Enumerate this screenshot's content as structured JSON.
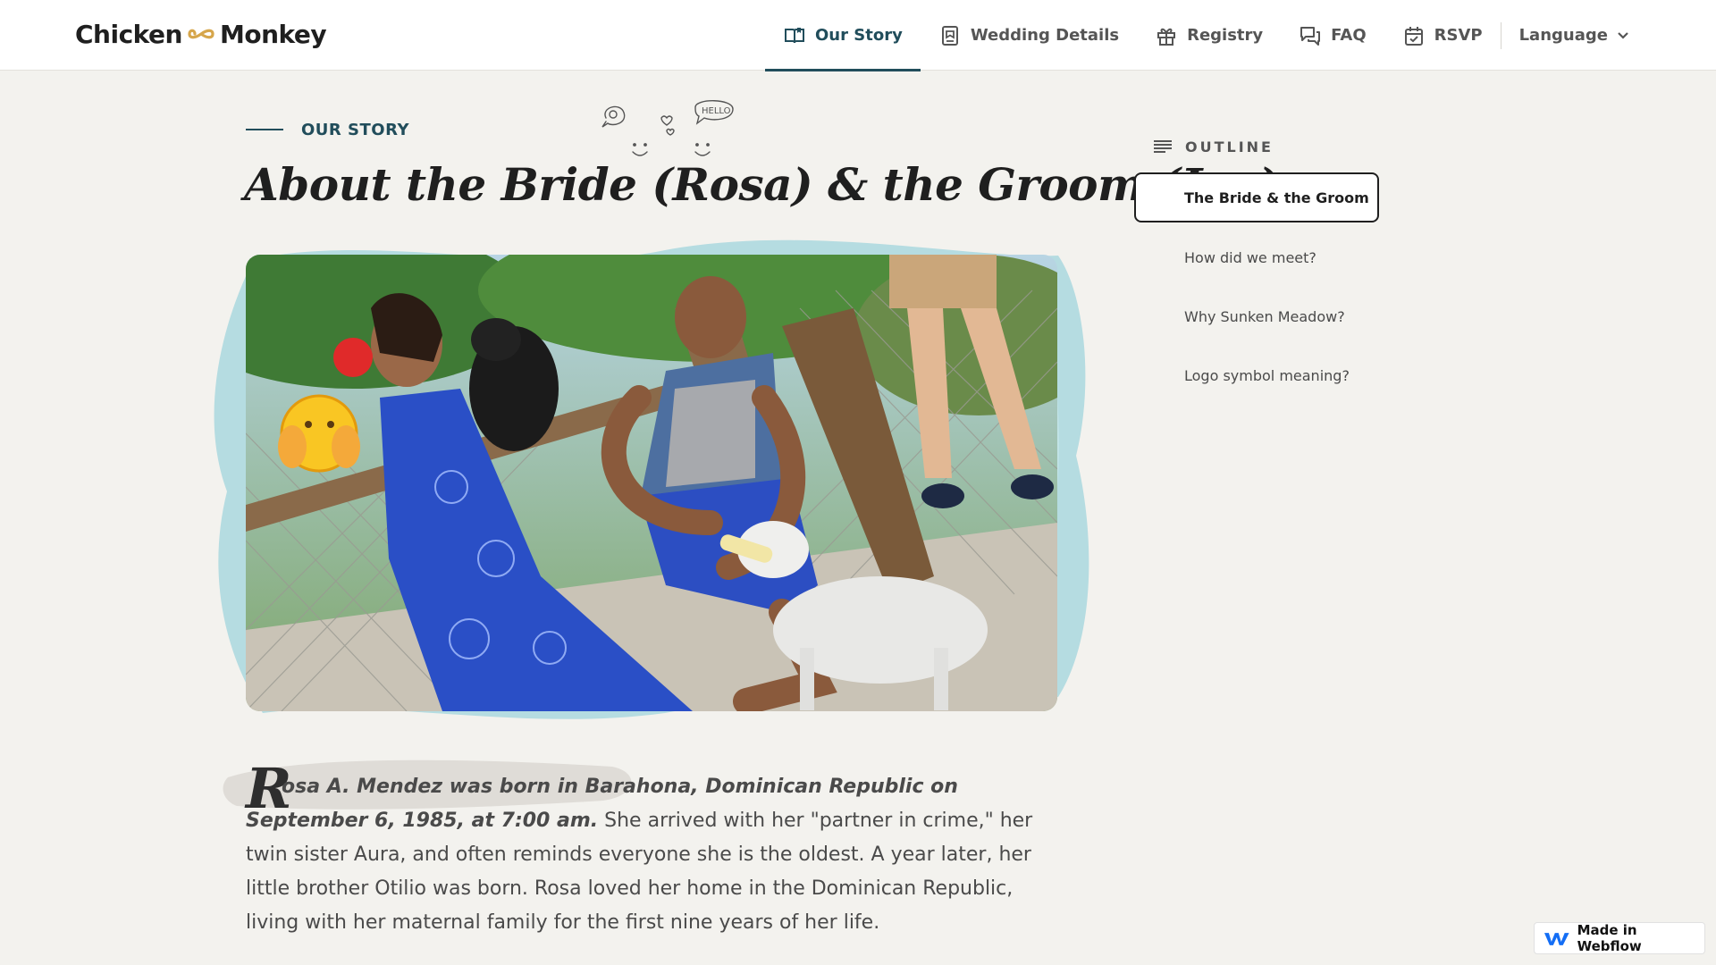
{
  "brand": {
    "name_left": "Chicken",
    "name_right": "Monkey",
    "symbol_color": "#d6a64b"
  },
  "nav": {
    "items": [
      {
        "label": "Our Story",
        "icon": "open-book-icon",
        "active": true
      },
      {
        "label": "Wedding Details",
        "icon": "document-icon",
        "active": false
      },
      {
        "label": "Registry",
        "icon": "gift-icon",
        "active": false
      },
      {
        "label": "FAQ",
        "icon": "chat-bubbles-icon",
        "active": false
      },
      {
        "label": "RSVP",
        "icon": "calendar-check-icon",
        "active": false
      }
    ],
    "language_label": "Language",
    "accent_color": "#214d5b"
  },
  "story": {
    "eyebrow": "OUR STORY",
    "doodle_text": "HELLO",
    "title": "About the Bride (Rosa) & the Groom (Joe)",
    "photo_icon": "couple-photo-image",
    "dropcap": "R",
    "lead_rest": "osa A. Mendez was born in Barahona, Dominican Republic on September 6, 1985, at 7:00 am.",
    "body": " She arrived with her \"partner in crime,\" her twin sister Aura, and often reminds everyone she is the oldest. A year later, her little brother Otilio was born. Rosa loved her home in the Dominican Republic, living with her maternal family for the first nine years of her life."
  },
  "outline": {
    "label": "OUTLINE",
    "active_item": "The Bride & the Groom",
    "items": [
      "How did we meet?",
      "Why Sunken Meadow?",
      "Logo symbol meaning?"
    ]
  },
  "badge": {
    "label": "Made in Webflow"
  },
  "colors": {
    "page_bg": "#f3f2ee",
    "splash": "#9fd3da"
  }
}
